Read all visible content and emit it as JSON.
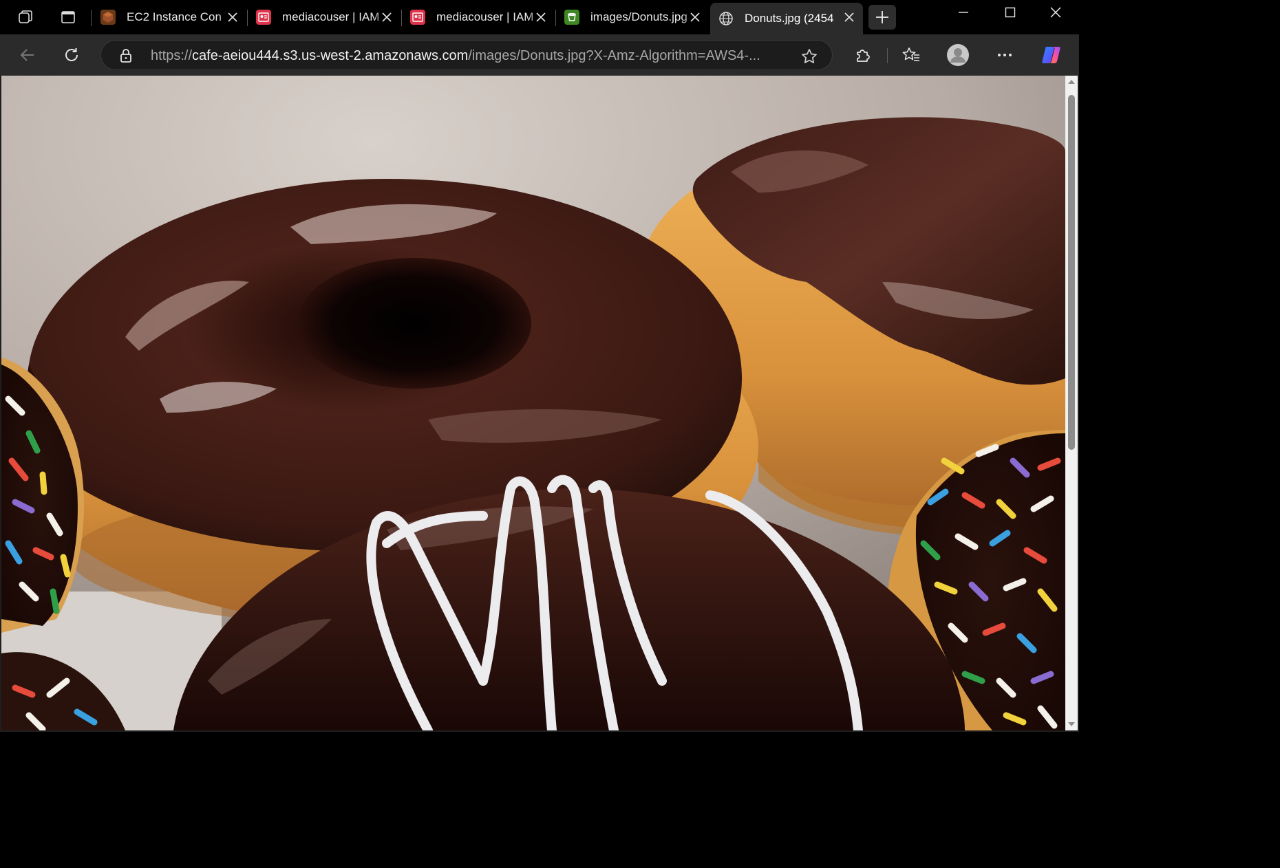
{
  "window": {
    "minimize_icon": "minimize-icon",
    "maximize_icon": "maximize-icon",
    "close_icon": "close-icon"
  },
  "tabs": [
    {
      "title": "EC2 Instance Con",
      "icon": "aws-ec2-icon",
      "color": "#8c4f1f"
    },
    {
      "title": "mediacouser | IAM",
      "icon": "aws-iam-icon",
      "color": "#dd344c"
    },
    {
      "title": "mediacouser | IAM",
      "icon": "aws-iam-icon",
      "color": "#dd344c"
    },
    {
      "title": "images/Donuts.jpg",
      "icon": "aws-s3-icon",
      "color": "#3f8624"
    },
    {
      "title": "Donuts.jpg (2454",
      "icon": "globe-icon",
      "active": true
    }
  ],
  "address_bar": {
    "scheme": "https://",
    "host": "cafe-aeiou444.s3.us-west-2.amazonaws.com",
    "path": "/images/Donuts.jpg?X-Amz-Algorithm=AWS4-..."
  },
  "content": {
    "image_description_icon": "donuts-photo",
    "colors": {
      "chocolate": "#3a1a14",
      "dough": "#d99a45",
      "icing": "#e8e8ea",
      "background": "#c9bfb8"
    }
  }
}
